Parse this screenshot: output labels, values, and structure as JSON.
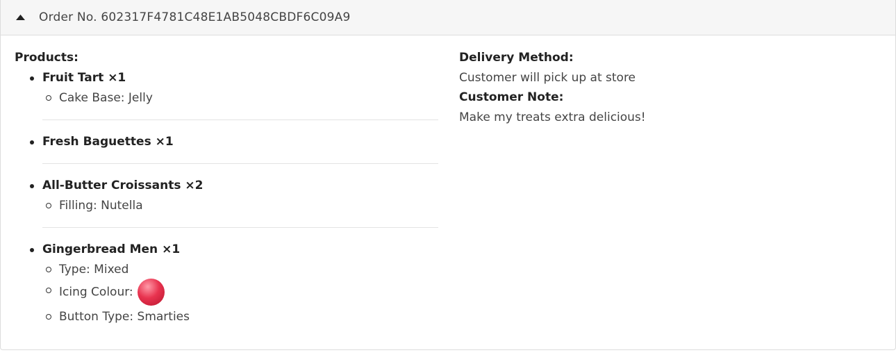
{
  "order": {
    "title": "Order No. 602317F4781C48E1AB5048CBDF6C09A9",
    "expanded": true,
    "toggle_icon": "caret-up-icon"
  },
  "products": {
    "label": "Products:",
    "items": [
      {
        "name": "Fruit Tart ×1",
        "options": [
          {
            "text": "Cake Base: Jelly"
          }
        ]
      },
      {
        "name": "Fresh Baguettes ×1",
        "options": []
      },
      {
        "name": "All-Butter Croissants ×2",
        "options": [
          {
            "text": "Filling: Nutella"
          }
        ]
      },
      {
        "name": "Gingerbread Men ×1",
        "options": [
          {
            "text": "Type: Mixed"
          },
          {
            "text": "Icing Colour:",
            "swatch_color": "#e8334f"
          },
          {
            "text": "Button Type: Smarties"
          }
        ]
      }
    ]
  },
  "delivery": {
    "label": "Delivery Method:",
    "value": "Customer will pick up at store"
  },
  "note": {
    "label": "Customer Note:",
    "value": "Make my treats extra delicious!"
  },
  "colors": {
    "header_bg": "#f6f6f6",
    "border": "#dcdcdc",
    "divider": "#e3e3e3",
    "text": "#444444",
    "heading": "#222222"
  }
}
